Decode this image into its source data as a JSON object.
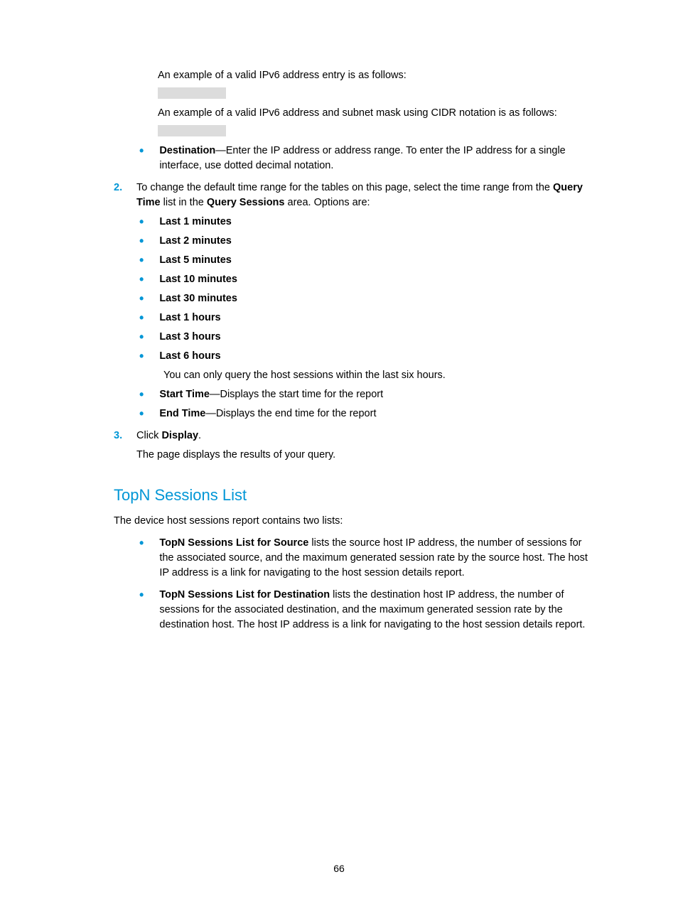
{
  "intro": {
    "line1": "An example of a valid IPv6 address entry is as follows:",
    "line2": "An example of a valid IPv6 address and subnet mask using CIDR notation is as follows:"
  },
  "destination": {
    "label": "Destination",
    "text": "—Enter the IP address or address range. To enter the IP address for a single interface, use dotted decimal notation."
  },
  "step2": {
    "num": "2.",
    "prefix": "To change the default time range for the tables on this page, select the time range from the ",
    "bold1": "Query Time",
    "middle": " list in the ",
    "bold2": "Query Sessions",
    "suffix": " area. Options are:"
  },
  "options": [
    "Last 1 minutes",
    "Last 2 minutes",
    "Last 5 minutes",
    "Last 10 minutes",
    "Last 30 minutes",
    "Last 1 hours",
    "Last 3 hours",
    "Last 6 hours"
  ],
  "note": "You can only query the host sessions within the last six hours.",
  "startTime": {
    "label": "Start Time",
    "text": "—Displays the start time for the report"
  },
  "endTime": {
    "label": "End Time",
    "text": "—Displays the end time for the report"
  },
  "step3": {
    "num": "3.",
    "prefix": "Click ",
    "bold": "Display",
    "suffix": "."
  },
  "resultLine": "The page displays the results of your query.",
  "section": {
    "heading": "TopN Sessions List",
    "intro": "The device host sessions report contains two lists:"
  },
  "topn": {
    "source": {
      "label": "TopN Sessions List for Source",
      "text": " lists the source host IP address, the number of sessions for the associated source, and the maximum generated session rate by the source host. The host IP address is a link for navigating to the host session details report."
    },
    "dest": {
      "label": "TopN Sessions List for Destination",
      "text": " lists the destination host IP address, the number of sessions for the associated destination, and the maximum generated session rate by the destination host. The host IP address is a link for navigating to the host session details report."
    }
  },
  "pageNumber": "66"
}
